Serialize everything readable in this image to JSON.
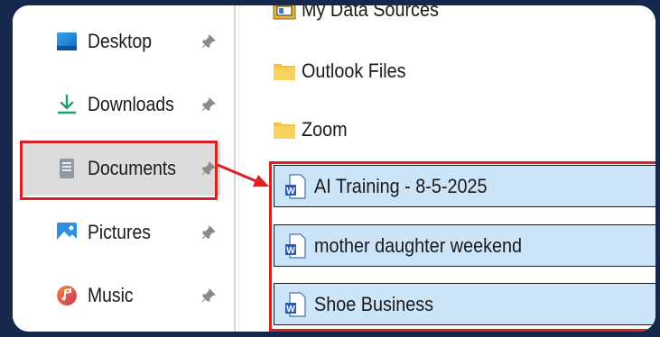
{
  "nav": {
    "items": [
      {
        "label": "Desktop",
        "icon": "desktop-icon"
      },
      {
        "label": "Downloads",
        "icon": "download-icon"
      },
      {
        "label": "Documents",
        "icon": "documents-icon",
        "selected": true
      },
      {
        "label": "Pictures",
        "icon": "pictures-icon"
      },
      {
        "label": "Music",
        "icon": "music-icon"
      }
    ]
  },
  "files": {
    "folders": [
      {
        "label": "My Data Sources"
      },
      {
        "label": "Outlook Files"
      },
      {
        "label": "Zoom"
      }
    ],
    "documents": [
      {
        "label": "AI Training - 8-5-2025"
      },
      {
        "label": "mother daughter weekend"
      },
      {
        "label": "Shoe Business"
      }
    ]
  },
  "colors": {
    "background": "#17284e",
    "annotation_red": "#d92121",
    "selected_row": "#cce4f7",
    "nav_selected": "#dcdcdc",
    "folder_yellow": "#f4c23c",
    "word_blue": "#2b5fb3"
  }
}
